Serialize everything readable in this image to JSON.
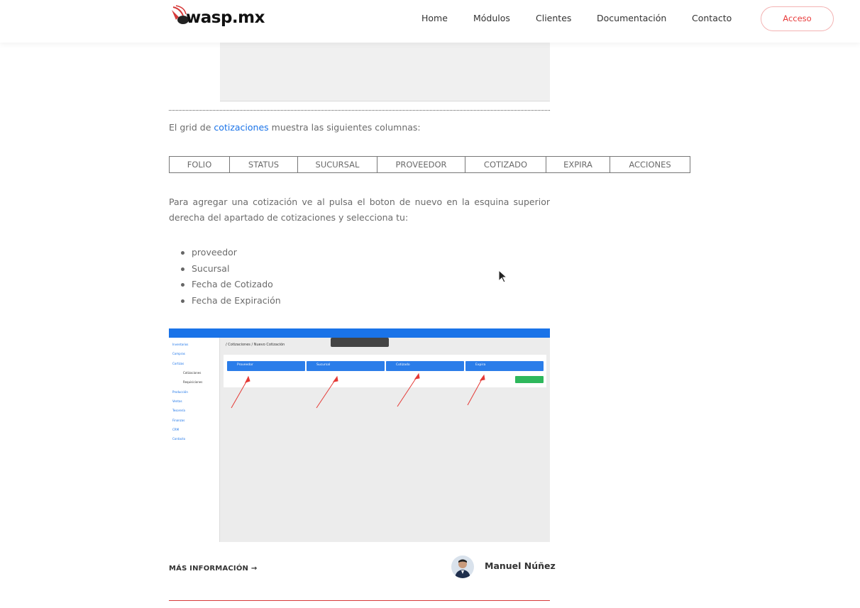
{
  "header": {
    "logo_text": "wasp.mx",
    "nav": [
      "Home",
      "Módulos",
      "Clientes",
      "Documentación",
      "Contacto"
    ],
    "login_label": "Acceso"
  },
  "content": {
    "intro_prefix": "El grid de",
    "intro_link": "cotizaciones",
    "intro_suffix": "muestra las siguientes columnas:",
    "table_columns": [
      "FOLIO",
      "STATUS",
      "SUCURSAL",
      "PROVEEDOR",
      "COTIZADO",
      "EXPIRA",
      "ACCIONES"
    ],
    "instructions": "Para agregar una cotización ve al pulsa el boton de nuevo en la esquina superior derecha del apartado de cotizaciones y selecciona tu:",
    "list": [
      "proveedor",
      "Sucursal",
      "Fecha de Cotizado",
      "Fecha de Expiración"
    ]
  },
  "screenshot": {
    "breadcrumb": "/ Cotizaciones / Nuevo Cotización",
    "menu": [
      "Inventarios",
      "Compras",
      "Cortizas",
      "Cotizaciones",
      "Requisiciones",
      "Producción",
      "Ventas",
      "Tesorería",
      "Finanzas",
      "CRM",
      "Contacto"
    ],
    "selects": [
      "Proveedor",
      "Sucursal",
      "Cotizado",
      "Expira"
    ],
    "button_label": "GUARDAR"
  },
  "footer": {
    "more_label": "MÁS INFORMACIÓN",
    "author": "Manuel Núñez"
  },
  "colors": {
    "link": "#1a73e8",
    "accent": "#e83a3a",
    "app_blue": "#2b7de9"
  }
}
